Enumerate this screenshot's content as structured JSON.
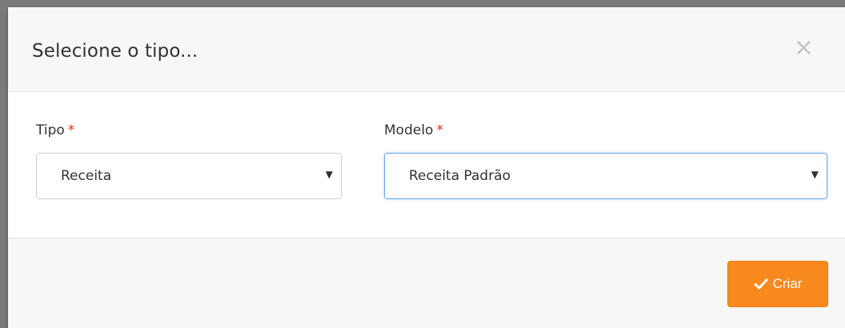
{
  "modal": {
    "title": "Selecione o tipo...",
    "close_symbol": "×",
    "fields": {
      "tipo": {
        "label": "Tipo",
        "required_mark": "*",
        "value": "Receita"
      },
      "modelo": {
        "label": "Modelo",
        "required_mark": "*",
        "value": "Receita Padrão"
      }
    },
    "submit_label": "Criar",
    "icons": {
      "submit": "check-icon",
      "dropdown": "caret-down-icon",
      "close": "close-icon"
    }
  },
  "colors": {
    "primary_button": "#f7891e",
    "required": "#e02b2b",
    "focus_border": "#66a6e8"
  }
}
